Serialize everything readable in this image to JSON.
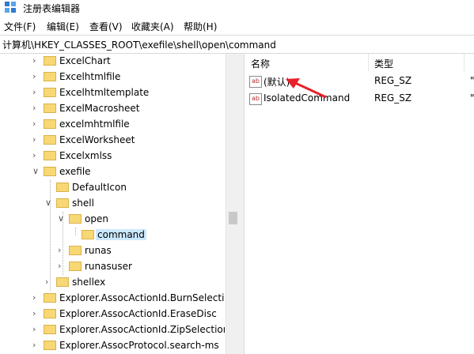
{
  "window": {
    "title": "注册表编辑器"
  },
  "menu": [
    "文件(F)",
    "编辑(E)",
    "查看(V)",
    "收藏夹(A)",
    "帮助(H)"
  ],
  "address": "计算机\\HKEY_CLASSES_ROOT\\exefile\\shell\\open\\command",
  "tree": [
    {
      "label": "ExcelChart",
      "depth": 0,
      "state": "collapsed"
    },
    {
      "label": "Excelhtmlfile",
      "depth": 0,
      "state": "collapsed"
    },
    {
      "label": "Excelhtmltemplate",
      "depth": 0,
      "state": "collapsed"
    },
    {
      "label": "ExcelMacrosheet",
      "depth": 0,
      "state": "collapsed"
    },
    {
      "label": "excelmhtmlfile",
      "depth": 0,
      "state": "collapsed"
    },
    {
      "label": "ExcelWorksheet",
      "depth": 0,
      "state": "collapsed"
    },
    {
      "label": "Excelxmlss",
      "depth": 0,
      "state": "collapsed"
    },
    {
      "label": "exefile",
      "depth": 0,
      "state": "expanded"
    },
    {
      "label": "DefaultIcon",
      "depth": 1,
      "state": "none"
    },
    {
      "label": "shell",
      "depth": 1,
      "state": "expanded"
    },
    {
      "label": "open",
      "depth": 2,
      "state": "expanded"
    },
    {
      "label": "command",
      "depth": 3,
      "state": "none",
      "selected": true
    },
    {
      "label": "runas",
      "depth": 2,
      "state": "collapsed"
    },
    {
      "label": "runasuser",
      "depth": 2,
      "state": "collapsed"
    },
    {
      "label": "shellex",
      "depth": 1,
      "state": "collapsed"
    },
    {
      "label": "Explorer.AssocActionId.BurnSelection",
      "depth": 0,
      "state": "collapsed"
    },
    {
      "label": "Explorer.AssocActionId.EraseDisc",
      "depth": 0,
      "state": "collapsed"
    },
    {
      "label": "Explorer.AssocActionId.ZipSelection",
      "depth": 0,
      "state": "collapsed"
    },
    {
      "label": "Explorer.AssocProtocol.search-ms",
      "depth": 0,
      "state": "collapsed"
    }
  ],
  "values_pane": {
    "columns": {
      "name": "名称",
      "type": "类型"
    },
    "rows": [
      {
        "name": "(默认)",
        "type": "REG_SZ",
        "data": "\""
      },
      {
        "name": "IsolatedCommand",
        "type": "REG_SZ",
        "data": "\""
      }
    ],
    "value_icon_text": "ab"
  },
  "colors": {
    "selection": "#cce8ff",
    "folder": "#f8d775",
    "annotation_arrow": "#e8202a"
  }
}
